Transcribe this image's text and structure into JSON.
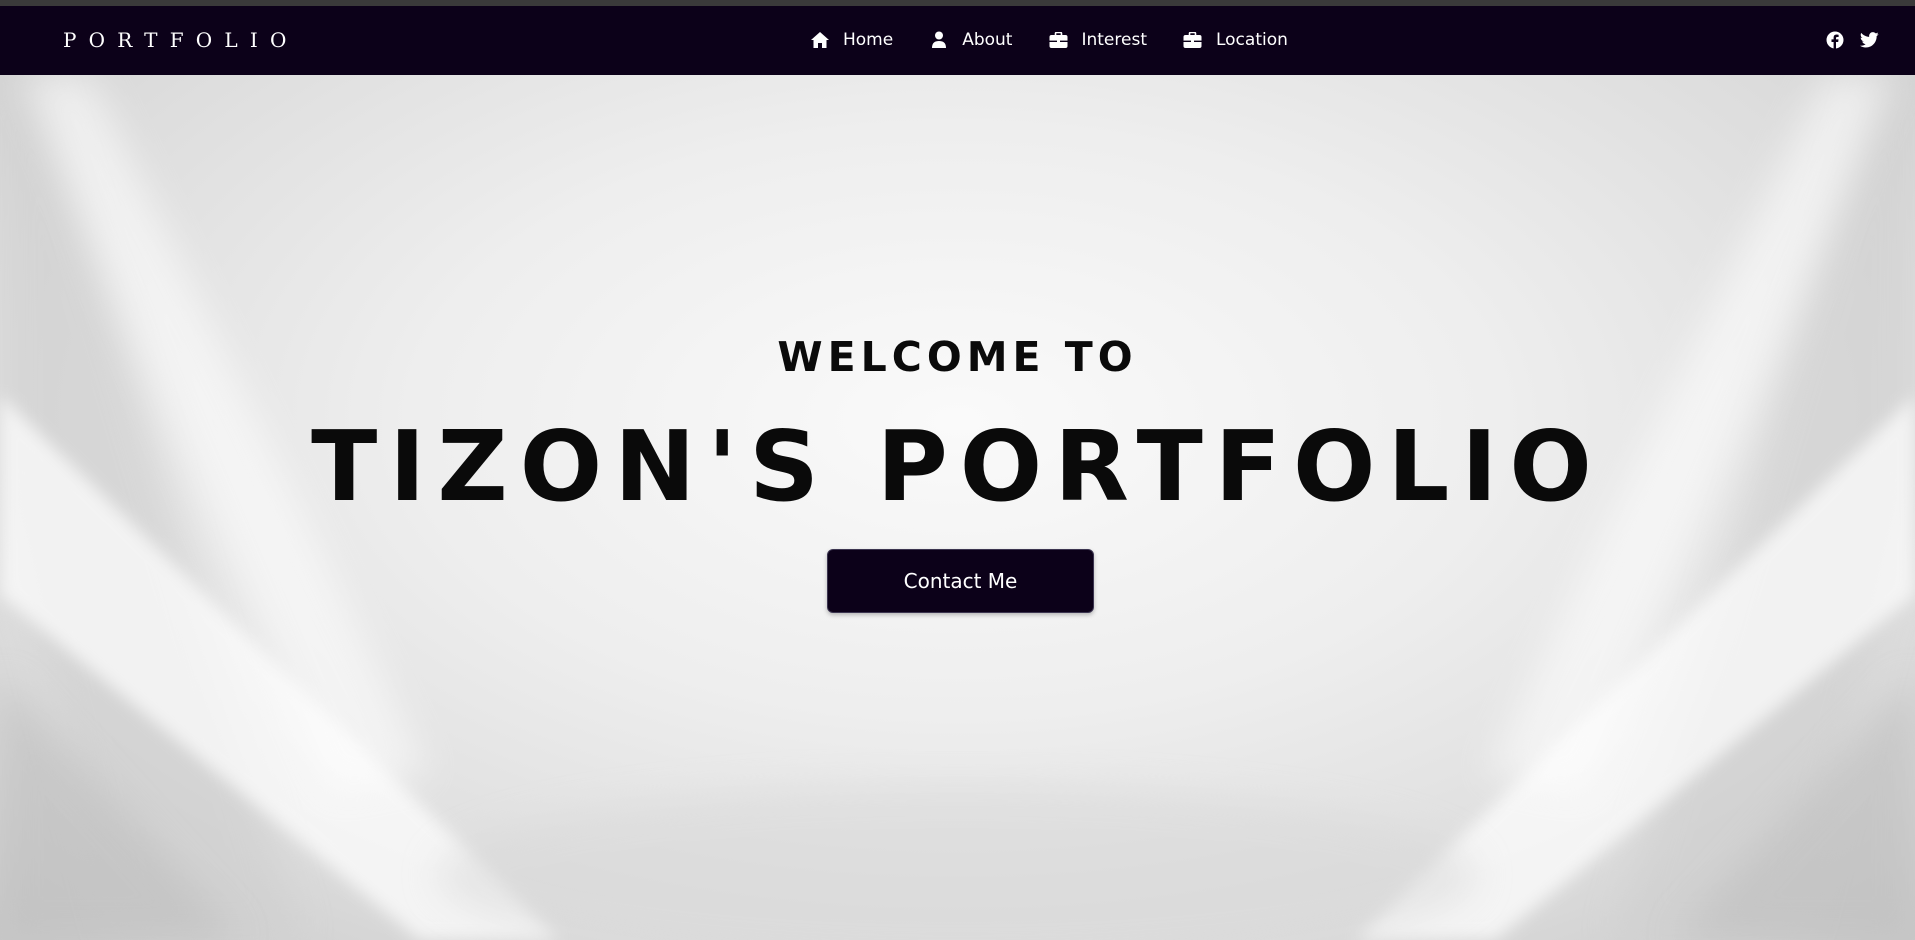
{
  "colors": {
    "nav_bg": "#0c0119",
    "hero_text": "#0a0a0a",
    "button_bg": "#0c0119",
    "button_text": "#ffffff"
  },
  "navbar": {
    "brand": "PORTFOLIO",
    "links": [
      {
        "label": "Home",
        "icon": "home-icon"
      },
      {
        "label": "About",
        "icon": "user-icon"
      },
      {
        "label": "Interest",
        "icon": "briefcase-icon"
      },
      {
        "label": "Location",
        "icon": "briefcase-icon"
      }
    ],
    "social": [
      {
        "icon": "facebook-icon"
      },
      {
        "icon": "twitter-icon"
      }
    ]
  },
  "hero": {
    "subtitle": "WELCOME TO",
    "title": "TIZON'S PORTFOLIO",
    "cta_label": "Contact Me"
  }
}
